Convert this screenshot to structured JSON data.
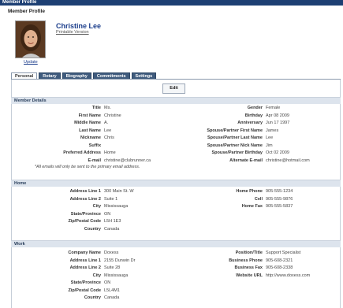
{
  "window": {
    "title": "Member Profile"
  },
  "page": {
    "heading": "Member Profile"
  },
  "profile": {
    "name": "Christine Lee",
    "printable_label": "Printable Version",
    "update_label": "Update"
  },
  "tabs": [
    {
      "label": "Personal",
      "active": true
    },
    {
      "label": "Rotary",
      "active": false
    },
    {
      "label": "Biography",
      "active": false
    },
    {
      "label": "Commitments",
      "active": false
    },
    {
      "label": "Settings",
      "active": false
    }
  ],
  "edit_label": "Edit",
  "sections": {
    "member_details": "Member Details",
    "home": "Home",
    "work": "Work"
  },
  "member_left": [
    {
      "label": "Title",
      "value": "Ms."
    },
    {
      "label": "First Name",
      "value": "Christine"
    },
    {
      "label": "Middle Name",
      "value": "A."
    },
    {
      "label": "Last Name",
      "value": "Lee"
    },
    {
      "label": "Nickname",
      "value": "Chris"
    },
    {
      "label": "Suffix",
      "value": ""
    },
    {
      "label": "Preferred Address",
      "value": "Home"
    },
    {
      "label": "E-mail",
      "value": "christine@clubrunner.ca"
    }
  ],
  "member_right": [
    {
      "label": "Gender",
      "value": "Female"
    },
    {
      "label": "Birthday",
      "value": "Apr 08 2009"
    },
    {
      "label": "Anniversary",
      "value": "Jun 17 1997"
    },
    {
      "label": "Spouse/Partner First Name",
      "value": "James"
    },
    {
      "label": "Spouse/Partner Last Name",
      "value": "Lee"
    },
    {
      "label": "Spouse/Partner Nick Name",
      "value": "Jim"
    },
    {
      "label": "Spouse/Partner Birthday",
      "value": "Oct 02 2009"
    },
    {
      "label": "Alternate E-mail",
      "value": "christine@hotmail.com"
    }
  ],
  "email_note": "*All emails will only be sent to the primary email address.",
  "home_left": [
    {
      "label": "Address Line 1",
      "value": "300 Main St. W"
    },
    {
      "label": "Address Line 2",
      "value": "Suite 1"
    },
    {
      "label": "City",
      "value": "Mississauga"
    },
    {
      "label": "State/Province",
      "value": "ON"
    },
    {
      "label": "Zip/Postal Code",
      "value": "L5H 1E3"
    },
    {
      "label": "Country",
      "value": "Canada"
    }
  ],
  "home_right": [
    {
      "label": "Home Phone",
      "value": "905-555-1234"
    },
    {
      "label": "Cell",
      "value": "905-555-9876"
    },
    {
      "label": "Home Fax",
      "value": "905-555-5837"
    }
  ],
  "work_left": [
    {
      "label": "Company Name",
      "value": "Doxess"
    },
    {
      "label": "Address Line 1",
      "value": "2155 Dunwin Dr"
    },
    {
      "label": "Address Line 2",
      "value": "Suite 28"
    },
    {
      "label": "City",
      "value": "Mississauga"
    },
    {
      "label": "State/Province",
      "value": "ON"
    },
    {
      "label": "Zip/Postal Code",
      "value": "L5L4M1"
    },
    {
      "label": "Country",
      "value": "Canada"
    }
  ],
  "work_right": [
    {
      "label": "Position/Title",
      "value": "Support Specialist"
    },
    {
      "label": "Business Phone",
      "value": "905-608-2321"
    },
    {
      "label": "Business Fax",
      "value": "905-608-2338"
    },
    {
      "label": "Website URL",
      "value": "http://www.doxess.com"
    }
  ]
}
